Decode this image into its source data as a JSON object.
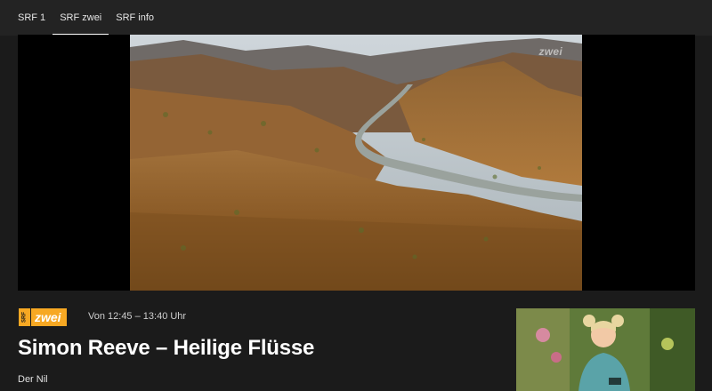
{
  "nav": {
    "tabs": [
      {
        "label": "SRF 1"
      },
      {
        "label": "SRF zwei",
        "active": true
      },
      {
        "label": "SRF info"
      }
    ]
  },
  "player": {
    "watermark": "zwei"
  },
  "program": {
    "logo_srf": "SRF",
    "logo_zwei": "zwei",
    "time": "Von 12:45 – 13:40 Uhr",
    "title": "Simon Reeve – Heilige Flüsse",
    "subtitle": "Der Nil"
  },
  "colors": {
    "accent": "#f7a823",
    "background": "#1b1b1b",
    "nav_background": "#232323"
  }
}
